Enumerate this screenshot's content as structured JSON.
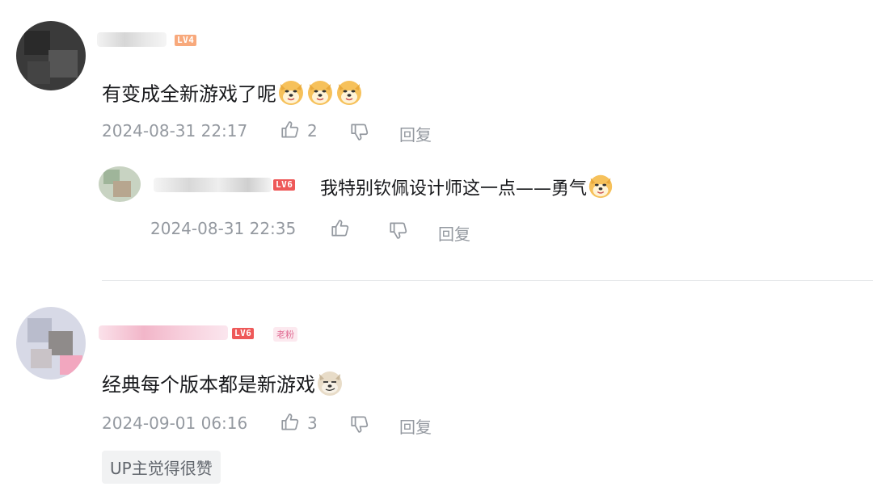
{
  "comments": [
    {
      "level": "LV4",
      "text": "有变成全新游戏了呢",
      "time": "2024-08-31 22:17",
      "likes": "2",
      "reply_label": "回复",
      "reply": {
        "level": "LV6",
        "text": "我特别钦佩设计师这一点——勇气",
        "time": "2024-08-31 22:35",
        "reply_label": "回复"
      }
    },
    {
      "level": "LV6",
      "fan_tag": "老粉",
      "text": "经典每个版本都是新游戏",
      "time": "2024-09-01 06:16",
      "likes": "3",
      "reply_label": "回复",
      "up_chip": "UP主觉得很赞"
    }
  ],
  "colors": {
    "lv4": "#f8a97c",
    "lv6": "#ee5959",
    "text": "#18191c",
    "meta": "#9499a0",
    "divider": "#e3e5e7"
  },
  "icons": [
    "like-icon",
    "dislike-icon",
    "doge-emoji-icon",
    "smirk-emoji-icon"
  ]
}
